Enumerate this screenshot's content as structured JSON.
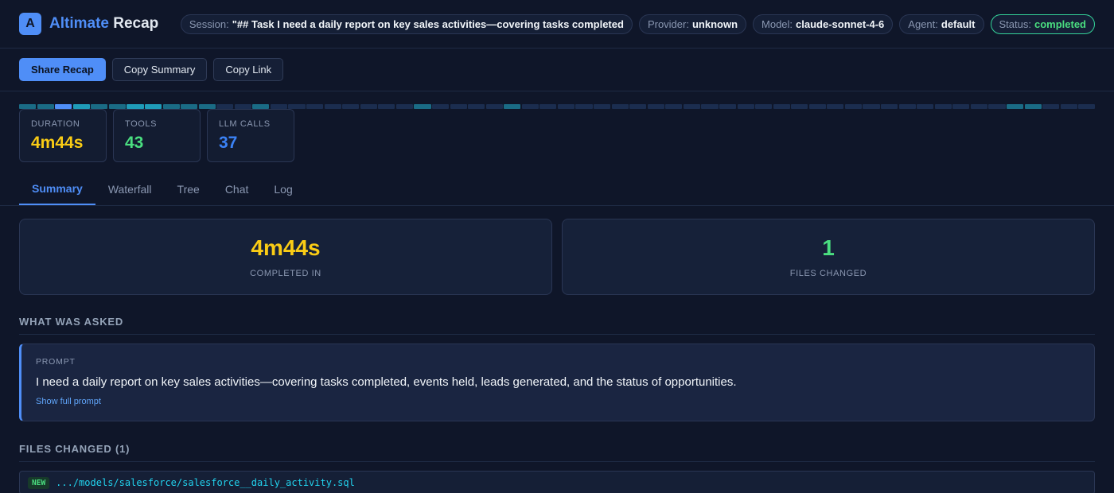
{
  "header": {
    "logo_letter": "A",
    "brand_part1": "Altimate",
    "brand_part2": "Recap",
    "pills": {
      "session_key": "Session:",
      "session_val": "\"## Task I need a daily report on key sales activities—covering tasks completed",
      "provider_key": "Provider:",
      "provider_val": "unknown",
      "model_key": "Model:",
      "model_val": "claude-sonnet-4-6",
      "agent_key": "Agent:",
      "agent_val": "default",
      "status_key": "Status:",
      "status_val": "completed"
    }
  },
  "toolbar": {
    "share_label": "Share Recap",
    "copy_summary_label": "Copy Summary",
    "copy_link_label": "Copy Link"
  },
  "activity_strip": {
    "colors": {
      "dark": "#1b2d4f",
      "teal": "#1a6b85",
      "cyan": "#1f9bb8",
      "blue": "#4f8ef7"
    },
    "segments": [
      "teal",
      "teal",
      "blue",
      "cyan",
      "teal",
      "teal",
      "cyan",
      "cyan",
      "teal",
      "teal",
      "teal",
      "dark",
      "dark",
      "teal",
      "dark",
      "dark",
      "dark",
      "dark",
      "dark",
      "dark",
      "dark",
      "dark",
      "teal",
      "dark",
      "dark",
      "dark",
      "dark",
      "teal",
      "dark",
      "dark",
      "dark",
      "dark",
      "dark",
      "dark",
      "dark",
      "dark",
      "dark",
      "dark",
      "dark",
      "dark",
      "dark",
      "dark",
      "dark",
      "dark",
      "dark",
      "dark",
      "dark",
      "dark",
      "dark",
      "dark",
      "dark",
      "dark",
      "dark",
      "dark",
      "dark",
      "teal",
      "teal",
      "dark",
      "dark",
      "dark"
    ]
  },
  "stats": {
    "duration_label": "DURATION",
    "duration_value": "4m44s",
    "tools_label": "TOOLS",
    "tools_value": "43",
    "llm_label": "LLM CALLS",
    "llm_value": "37"
  },
  "tabs": [
    "Summary",
    "Waterfall",
    "Tree",
    "Chat",
    "Log"
  ],
  "summary": {
    "completed_value": "4m44s",
    "completed_label": "COMPLETED IN",
    "files_value": "1",
    "files_label": "FILES CHANGED"
  },
  "asked": {
    "section_title": "WHAT WAS ASKED",
    "prompt_label": "PROMPT",
    "prompt_text": "I need a daily report on key sales activities—covering tasks completed, events held, leads generated, and the status of opportunities.",
    "show_full": "Show full prompt"
  },
  "files": {
    "section_title": "FILES CHANGED (1)",
    "items": [
      {
        "badge": "NEW",
        "path": ".../models/salesforce/salesforce__daily_activity.sql"
      }
    ]
  },
  "colors": {
    "accent": "#4f8ef7",
    "duration": "#facc15",
    "tools": "#4ade80",
    "llm": "#3b82f6",
    "status": "#4ade80"
  }
}
